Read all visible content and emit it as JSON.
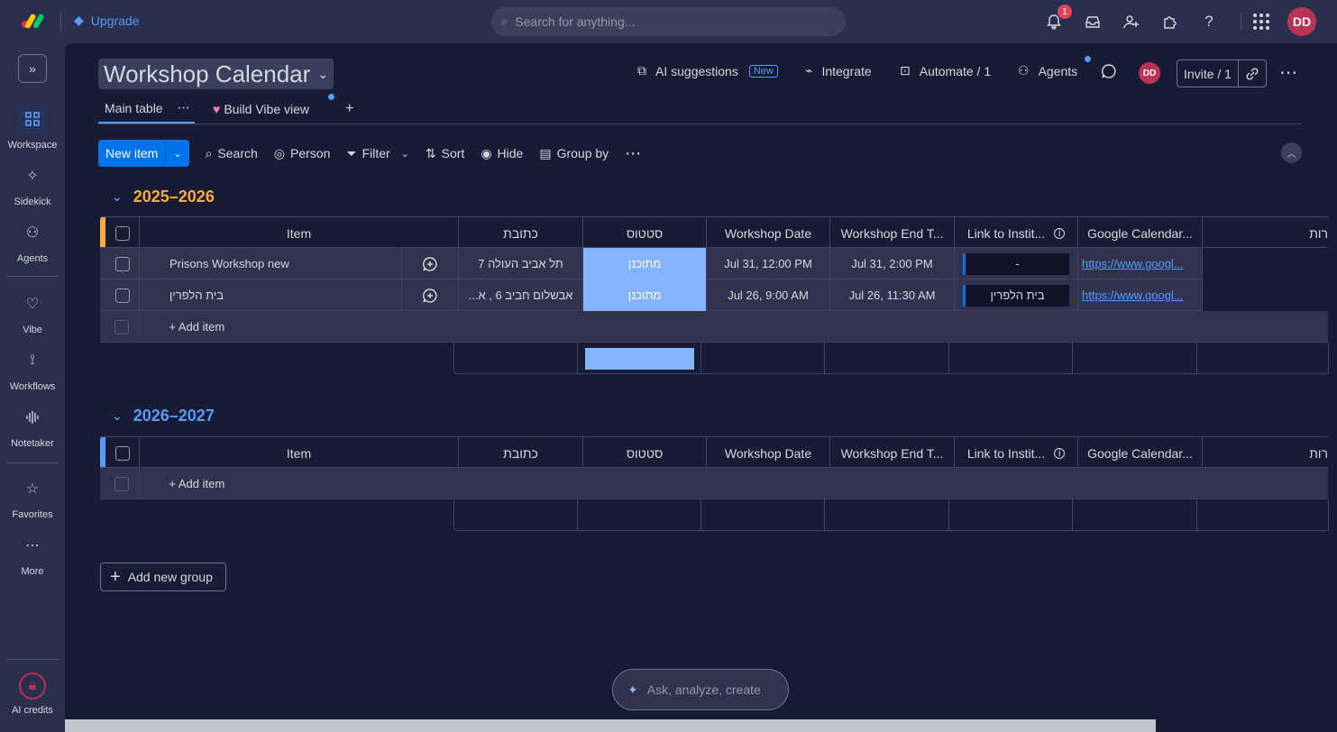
{
  "topbar": {
    "upgrade_label": "Upgrade",
    "search_placeholder": "Search for anything...",
    "notification_count": "1",
    "avatar_initials": "DD"
  },
  "sidebar": {
    "items": [
      {
        "label": "Workspace",
        "icon": "grid-icon"
      },
      {
        "label": "Sidekick",
        "icon": "sparkle-icon"
      },
      {
        "label": "Agents",
        "icon": "agents-icon"
      },
      {
        "label": "Vibe",
        "icon": "heart-icon"
      },
      {
        "label": "Workflows",
        "icon": "workflows-icon"
      },
      {
        "label": "Notetaker",
        "icon": "audio-icon"
      },
      {
        "label": "Favorites",
        "icon": "star-icon"
      },
      {
        "label": "More",
        "icon": "more-icon"
      },
      {
        "label": "AI credits",
        "icon": "lock-icon"
      }
    ]
  },
  "board": {
    "title": "Workshop Calendar",
    "actions": {
      "ai_suggestions": "AI suggestions",
      "new_tag": "New",
      "integrate": "Integrate",
      "automate": "Automate / 1",
      "agents": "Agents",
      "avatar_initials": "DD",
      "invite": "Invite / 1"
    },
    "tabs": [
      {
        "label": "Main table"
      },
      {
        "label": "Build Vibe view"
      }
    ]
  },
  "toolbar": {
    "new_item": "New item",
    "search": "Search",
    "person": "Person",
    "filter": "Filter",
    "sort": "Sort",
    "hide": "Hide",
    "group_by": "Group by"
  },
  "columns": [
    "Item",
    "כתובת",
    "סטטוס",
    "Workshop Date",
    "Workshop End T...",
    "Link to Instit...",
    "Google Calendar...",
    "רות"
  ],
  "groups": [
    {
      "title": "2025–2026",
      "color": "#fdab3d",
      "rows": [
        {
          "item": "Prisons Workshop new",
          "address": "תל אביב העולה 7",
          "status": "מתוכנן",
          "date": "Jul 31, 12:00 PM",
          "end": "Jul 31, 2:00 PM",
          "link": "-",
          "gcal": "https://www.googl..."
        },
        {
          "item": "בית הלפרין",
          "address": "אבשלום חביב 6 , א...",
          "status": "מתוכנן",
          "date": "Jul 26, 9:00 AM",
          "end": "Jul 26, 11:30 AM",
          "link": "בית הלפרין",
          "gcal": "https://www.googl..."
        }
      ],
      "add_item": "+ Add item"
    },
    {
      "title": "2026–2027",
      "color": "#579bfc",
      "rows": [],
      "add_item": "+ Add item"
    }
  ],
  "add_group_label": "Add new group",
  "ai_prompt_placeholder": "Ask, analyze, create"
}
